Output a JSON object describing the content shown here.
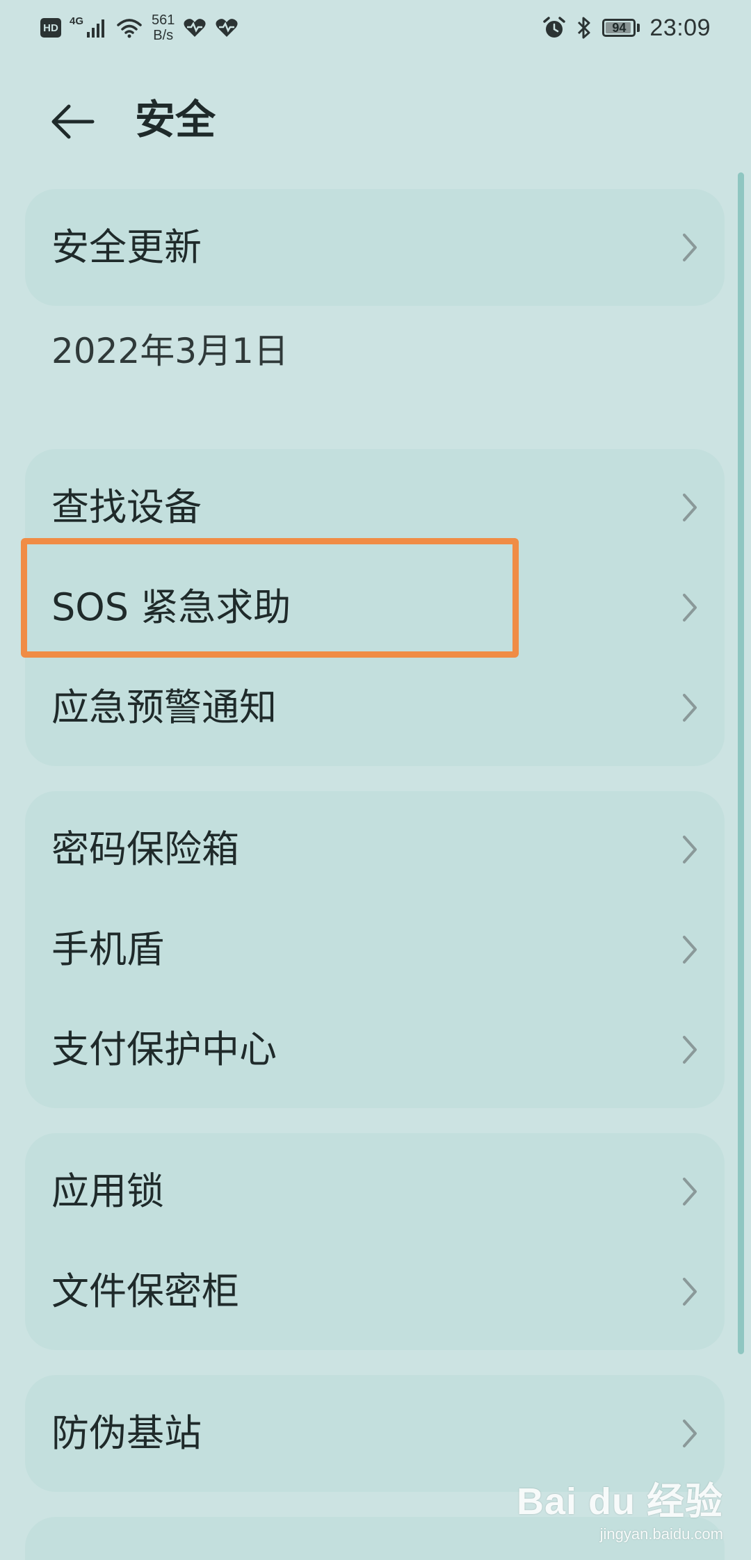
{
  "status_bar": {
    "hd": "HD",
    "network": "4G",
    "speed_value": "561",
    "speed_unit": "B/s",
    "battery": "94",
    "battery_level": 0.94,
    "time": "23:09"
  },
  "header": {
    "title": "安全"
  },
  "security_update": {
    "label": "安全更新",
    "date": "2022年3月1日"
  },
  "groups": [
    {
      "items": [
        {
          "label": "查找设备"
        },
        {
          "label": "SOS 紧急求助"
        },
        {
          "label": "应急预警通知"
        }
      ]
    },
    {
      "items": [
        {
          "label": "密码保险箱"
        },
        {
          "label": "手机盾"
        },
        {
          "label": "支付保护中心"
        }
      ]
    },
    {
      "items": [
        {
          "label": "应用锁"
        },
        {
          "label": "文件保密柜"
        }
      ]
    },
    {
      "items": [
        {
          "label": "防伪基站"
        }
      ]
    }
  ],
  "watermark": {
    "main": "Bai du 经验",
    "sub": "jingyan.baidu.com"
  },
  "colors": {
    "background": "#cce3e2",
    "card": "#c3dfdd",
    "highlight": "#f08c45",
    "scrollbar": "#8fc6c1"
  }
}
